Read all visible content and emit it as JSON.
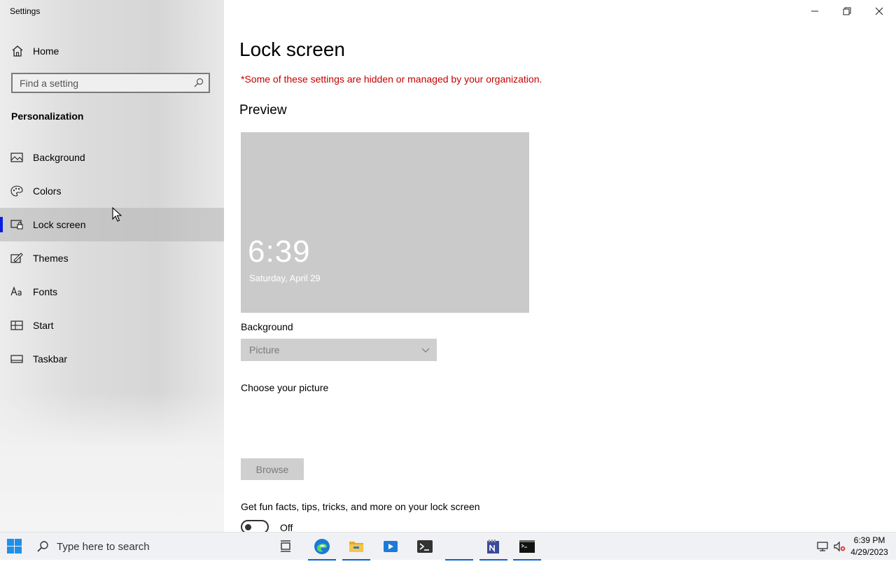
{
  "window": {
    "app_title": "Settings",
    "controls": [
      "minimize",
      "restore",
      "close"
    ]
  },
  "sidebar": {
    "home_label": "Home",
    "search_placeholder": "Find a setting",
    "section_heading": "Personalization",
    "items": [
      {
        "label": "Background",
        "icon": "picture-icon",
        "selected": false
      },
      {
        "label": "Colors",
        "icon": "palette-icon",
        "selected": false
      },
      {
        "label": "Lock screen",
        "icon": "lock-screen-icon",
        "selected": true
      },
      {
        "label": "Themes",
        "icon": "themes-icon",
        "selected": false
      },
      {
        "label": "Fonts",
        "icon": "fonts-icon",
        "selected": false
      },
      {
        "label": "Start",
        "icon": "start-icon",
        "selected": false
      },
      {
        "label": "Taskbar",
        "icon": "taskbar-icon",
        "selected": false
      }
    ]
  },
  "main": {
    "title": "Lock screen",
    "managed_warning": "*Some of these settings are hidden or managed by your organization.",
    "preview_heading": "Preview",
    "preview_time": "6:39",
    "preview_date": "Saturday, April 29",
    "background_label": "Background",
    "background_value": "Picture",
    "choose_picture_label": "Choose your picture",
    "browse_label": "Browse",
    "fun_facts_label": "Get fun facts, tips, tricks, and more on your lock screen",
    "fun_facts_toggle_state": "Off"
  },
  "taskbar": {
    "search_placeholder": "Type here to search",
    "apps": [
      "task-view",
      "edge",
      "file-explorer",
      "media-player",
      "terminal",
      "blank",
      "notepad-plus",
      "command-prompt"
    ],
    "clock_time": "6:39 PM",
    "clock_date": "4/29/2023"
  },
  "colors": {
    "accent": "#0a1ee0",
    "warning": "#c50000",
    "preview_bg": "#cacaca"
  }
}
